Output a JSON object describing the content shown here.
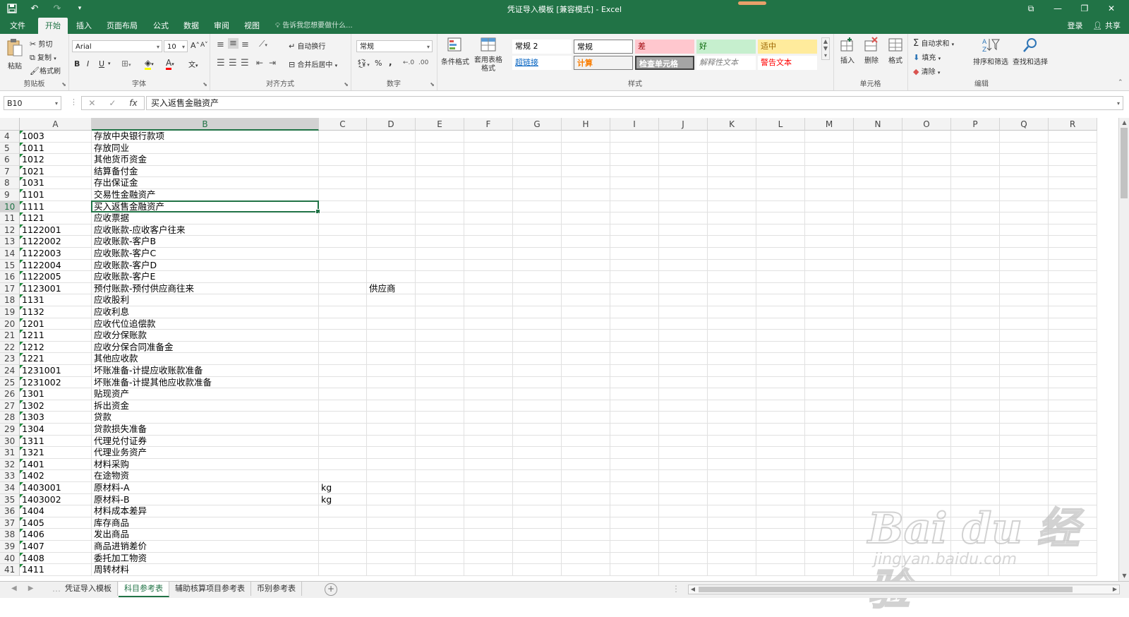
{
  "window": {
    "title": "凭证导入模板 [兼容模式] - Excel",
    "controls": [
      "⧉",
      "—",
      "❐",
      "✕"
    ]
  },
  "menu": {
    "tabs": [
      "文件",
      "开始",
      "插入",
      "页面布局",
      "公式",
      "数据",
      "审阅",
      "视图"
    ],
    "active": "开始",
    "tellme": "告诉我您想要做什么...",
    "login": "登录",
    "share": "共享"
  },
  "ribbon": {
    "clipboard": {
      "label": "剪贴板",
      "paste": "粘贴",
      "cut": "剪切",
      "copy": "复制",
      "painter": "格式刷"
    },
    "font": {
      "label": "字体",
      "name": "Arial",
      "size": "10",
      "bold": "B",
      "italic": "I",
      "underline": "U",
      "grow": "A",
      "shrink": "A"
    },
    "alignment": {
      "label": "对齐方式",
      "wrap": "自动换行",
      "merge": "合并后居中"
    },
    "number": {
      "label": "数字",
      "format": "常规",
      "percent": "%",
      "comma": ","
    },
    "styles": {
      "label": "样式",
      "cond": "条件格式",
      "table": "套用表格格式",
      "cells": [
        {
          "text": "常规 2",
          "bg": "#ffffff",
          "fg": "#000000"
        },
        {
          "text": "常规",
          "bg": "#ffffff",
          "fg": "#000000"
        },
        {
          "text": "差",
          "bg": "#ffc7ce",
          "fg": "#9c0006"
        },
        {
          "text": "好",
          "bg": "#c6efce",
          "fg": "#006100"
        },
        {
          "text": "适中",
          "bg": "#ffeb9c",
          "fg": "#9c6500"
        },
        {
          "text": "超链接",
          "bg": "#ffffff",
          "fg": "#0563c1"
        },
        {
          "text": "计算",
          "bg": "#f2f2f2",
          "fg": "#fa7d00"
        },
        {
          "text": "检查单元格",
          "bg": "#a5a5a5",
          "fg": "#ffffff"
        },
        {
          "text": "解释性文本",
          "bg": "#ffffff",
          "fg": "#7f7f7f"
        },
        {
          "text": "警告文本",
          "bg": "#ffffff",
          "fg": "#ff0000"
        }
      ]
    },
    "cells": {
      "label": "单元格",
      "insert": "插入",
      "delete": "删除",
      "format": "格式"
    },
    "editing": {
      "label": "编辑",
      "autosum": "自动求和",
      "fill": "填充",
      "clear": "清除",
      "sort": "排序和筛选",
      "find": "查找和选择"
    }
  },
  "formula": {
    "namebox": "B10",
    "cancel": "✕",
    "enter": "✓",
    "fx": "fx",
    "content": "买入返售金融资产"
  },
  "sheet": {
    "columns": [
      "A",
      "B",
      "C",
      "D",
      "E",
      "F",
      "G",
      "H",
      "I",
      "J",
      "K",
      "L",
      "M",
      "N",
      "O",
      "P",
      "Q",
      "R"
    ],
    "selected_col": "B",
    "selected_row": "10",
    "rows": [
      {
        "n": "4",
        "a": "1003",
        "b": "存放中央银行款项",
        "c": "",
        "d": ""
      },
      {
        "n": "5",
        "a": "1011",
        "b": "存放同业",
        "c": "",
        "d": ""
      },
      {
        "n": "6",
        "a": "1012",
        "b": "其他货币资金",
        "c": "",
        "d": ""
      },
      {
        "n": "7",
        "a": "1021",
        "b": "结算备付金",
        "c": "",
        "d": ""
      },
      {
        "n": "8",
        "a": "1031",
        "b": "存出保证金",
        "c": "",
        "d": ""
      },
      {
        "n": "9",
        "a": "1101",
        "b": "交易性金融资产",
        "c": "",
        "d": ""
      },
      {
        "n": "10",
        "a": "1111",
        "b": "买入返售金融资产",
        "c": "",
        "d": ""
      },
      {
        "n": "11",
        "a": "1121",
        "b": "应收票据",
        "c": "",
        "d": ""
      },
      {
        "n": "12",
        "a": "1122001",
        "b": "应收账款-应收客户往来",
        "c": "",
        "d": ""
      },
      {
        "n": "13",
        "a": "1122002",
        "b": "应收账款-客户B",
        "c": "",
        "d": ""
      },
      {
        "n": "14",
        "a": "1122003",
        "b": "应收账款-客户C",
        "c": "",
        "d": ""
      },
      {
        "n": "15",
        "a": "1122004",
        "b": "应收账款-客户D",
        "c": "",
        "d": ""
      },
      {
        "n": "16",
        "a": "1122005",
        "b": "应收账款-客户E",
        "c": "",
        "d": ""
      },
      {
        "n": "17",
        "a": "1123001",
        "b": "预付账款-预付供应商往来",
        "c": "",
        "d": "供应商"
      },
      {
        "n": "18",
        "a": "1131",
        "b": "应收股利",
        "c": "",
        "d": ""
      },
      {
        "n": "19",
        "a": "1132",
        "b": "应收利息",
        "c": "",
        "d": ""
      },
      {
        "n": "20",
        "a": "1201",
        "b": "应收代位追偿款",
        "c": "",
        "d": ""
      },
      {
        "n": "21",
        "a": "1211",
        "b": "应收分保账款",
        "c": "",
        "d": ""
      },
      {
        "n": "22",
        "a": "1212",
        "b": "应收分保合同准备金",
        "c": "",
        "d": ""
      },
      {
        "n": "23",
        "a": "1221",
        "b": "其他应收款",
        "c": "",
        "d": ""
      },
      {
        "n": "24",
        "a": "1231001",
        "b": "坏账准备-计提应收账款准备",
        "c": "",
        "d": ""
      },
      {
        "n": "25",
        "a": "1231002",
        "b": "坏账准备-计提其他应收款准备",
        "c": "",
        "d": ""
      },
      {
        "n": "26",
        "a": "1301",
        "b": "贴现资产",
        "c": "",
        "d": ""
      },
      {
        "n": "27",
        "a": "1302",
        "b": "拆出资金",
        "c": "",
        "d": ""
      },
      {
        "n": "28",
        "a": "1303",
        "b": "贷款",
        "c": "",
        "d": ""
      },
      {
        "n": "29",
        "a": "1304",
        "b": "贷款损失准备",
        "c": "",
        "d": ""
      },
      {
        "n": "30",
        "a": "1311",
        "b": "代理兑付证券",
        "c": "",
        "d": ""
      },
      {
        "n": "31",
        "a": "1321",
        "b": "代理业务资产",
        "c": "",
        "d": ""
      },
      {
        "n": "32",
        "a": "1401",
        "b": "材料采购",
        "c": "",
        "d": ""
      },
      {
        "n": "33",
        "a": "1402",
        "b": "在途物资",
        "c": "",
        "d": ""
      },
      {
        "n": "34",
        "a": "1403001",
        "b": "原材料-A",
        "c": "kg",
        "d": ""
      },
      {
        "n": "35",
        "a": "1403002",
        "b": "原材料-B",
        "c": "kg",
        "d": ""
      },
      {
        "n": "36",
        "a": "1404",
        "b": "材料成本差异",
        "c": "",
        "d": ""
      },
      {
        "n": "37",
        "a": "1405",
        "b": "库存商品",
        "c": "",
        "d": ""
      },
      {
        "n": "38",
        "a": "1406",
        "b": "发出商品",
        "c": "",
        "d": ""
      },
      {
        "n": "39",
        "a": "1407",
        "b": "商品进销差价",
        "c": "",
        "d": ""
      },
      {
        "n": "40",
        "a": "1408",
        "b": "委托加工物资",
        "c": "",
        "d": ""
      },
      {
        "n": "41",
        "a": "1411",
        "b": "周转材料",
        "c": "",
        "d": ""
      }
    ]
  },
  "tabs": {
    "sheets": [
      "凭证导入模板",
      "科目参考表",
      "辅助核算项目参考表",
      "币别参考表"
    ],
    "active": "科目参考表",
    "add": "+"
  },
  "watermark": {
    "logo": "Bai du 经验",
    "url": "jingyan.baidu.com"
  }
}
